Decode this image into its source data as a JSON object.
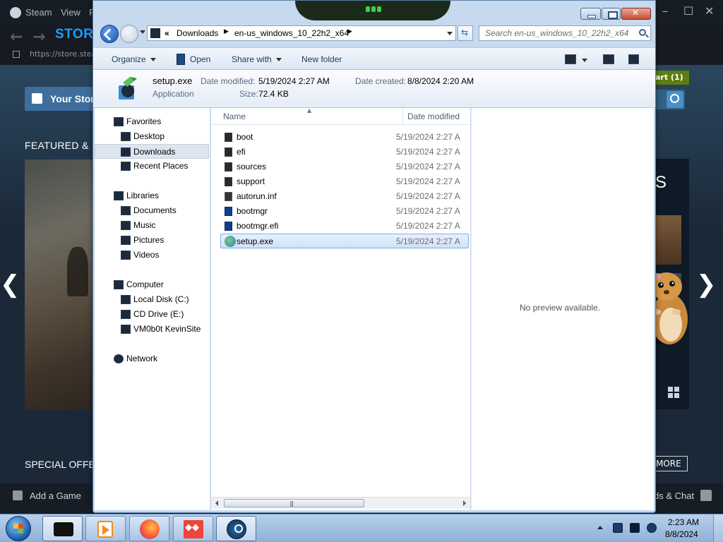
{
  "steam": {
    "menu": [
      "Steam",
      "View",
      "F"
    ],
    "store_tab": "STORE",
    "url": "https://store.steam",
    "your_store": "Your Stor",
    "featured": "FEATURED & R",
    "cart": "art (1)",
    "right_text": "S",
    "special_offers": "SPECIAL OFFE",
    "more": "MORE",
    "add_game": "Add a Game",
    "friends_chat": "ds & Chat",
    "window_controls": [
      "–",
      "☐",
      "✕"
    ]
  },
  "explorer": {
    "address": {
      "prefix": "«",
      "segments": [
        "Downloads",
        "en-us_windows_10_22h2_x64"
      ]
    },
    "search_placeholder": "Search en-us_windows_10_22h2_x64",
    "toolbar": {
      "organize": "Organize",
      "open": "Open",
      "share_with": "Share with",
      "new_folder": "New folder"
    },
    "details": {
      "file_name": "setup.exe",
      "file_type": "Application",
      "modified_label": "Date modified:",
      "modified_value": "5/19/2024 2:27 AM",
      "size_label": "Size:",
      "size_value": "72.4 KB",
      "created_label": "Date created:",
      "created_value": "8/8/2024 2:20 AM"
    },
    "nav": {
      "favorites": "Favorites",
      "desktop": "Desktop",
      "downloads": "Downloads",
      "recent_places": "Recent Places",
      "libraries": "Libraries",
      "documents": "Documents",
      "music": "Music",
      "pictures": "Pictures",
      "videos": "Videos",
      "computer": "Computer",
      "local_disk": "Local Disk (C:)",
      "cd_drive": "CD Drive (E:)",
      "vm_site": "VM0b0t KevinSite",
      "network": "Network"
    },
    "columns": {
      "name": "Name",
      "date_modified": "Date modified"
    },
    "files": [
      {
        "name": "boot",
        "date": "5/19/2024 2:27 A",
        "kind": "folder"
      },
      {
        "name": "efi",
        "date": "5/19/2024 2:27 A",
        "kind": "folder"
      },
      {
        "name": "sources",
        "date": "5/19/2024 2:27 A",
        "kind": "folder"
      },
      {
        "name": "support",
        "date": "5/19/2024 2:27 A",
        "kind": "folder"
      },
      {
        "name": "autorun.inf",
        "date": "5/19/2024 2:27 A",
        "kind": "inf"
      },
      {
        "name": "bootmgr",
        "date": "5/19/2024 2:27 A",
        "kind": "bin"
      },
      {
        "name": "bootmgr.efi",
        "date": "5/19/2024 2:27 A",
        "kind": "bin"
      },
      {
        "name": "setup.exe",
        "date": "5/19/2024 2:27 A",
        "kind": "exe",
        "selected": true
      }
    ],
    "preview_text": "No preview available."
  },
  "taskbar": {
    "apps": [
      "explorer",
      "media-player",
      "firefox",
      "anydesk",
      "steam"
    ],
    "clock_time": "2:23 AM",
    "clock_date": "8/8/2024"
  }
}
